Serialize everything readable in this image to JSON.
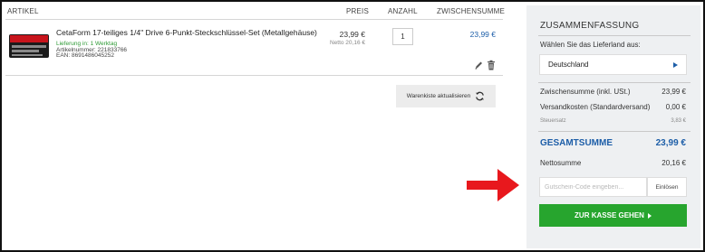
{
  "table": {
    "headers": {
      "article": "ARTIKEL",
      "price": "PREIS",
      "quantity": "ANZAHL",
      "subtotal": "ZWISCHENSUMME"
    }
  },
  "item": {
    "name": "CetaForm 17-teiliges 1/4\" Drive 6-Punkt-Steckschlüssel-Set (Metallgehäuse)",
    "delivery": "Lieferung in:  1 Werktag",
    "article_number": "Artikelnummer:  221833766",
    "ean": "EAN:   8691486045252",
    "price": "23,99 €",
    "netto": "Netto 20,16 €",
    "quantity": "1",
    "subtotal": "23,99 €",
    "edit_icon": "pencil-icon",
    "delete_icon": "trash-icon"
  },
  "update_button": {
    "label": "Warenkiste aktualisieren",
    "icon": "refresh-icon"
  },
  "summary": {
    "title": "ZUSAMMENFASSUNG",
    "country_label": "Wählen Sie das Lieferland aus:",
    "country_value": "Deutschland",
    "rows": [
      {
        "label": "Zwischensumme (inkl. USt.)",
        "value": "23,99 €"
      },
      {
        "label": "Versandkosten (Standardversand)",
        "value": "0,00 €"
      },
      {
        "label": "Steuersatz",
        "value": "3,83 €"
      },
      {
        "label": "GESAMTSUMME",
        "value": "23,99 €"
      },
      {
        "label": "Nettosumme",
        "value": "20,16 €"
      }
    ],
    "coupon_placeholder": "Gutschein-Code eingeben...",
    "redeem_label": "Einlösen",
    "checkout_label": "ZUR KASSE GEHEN"
  },
  "colors": {
    "accent_blue": "#1d5ea8",
    "checkout_green": "#27a52e",
    "delivery_green": "#2e9a35",
    "annotation_red": "#e8181d",
    "summary_bg": "#eef0f2"
  }
}
